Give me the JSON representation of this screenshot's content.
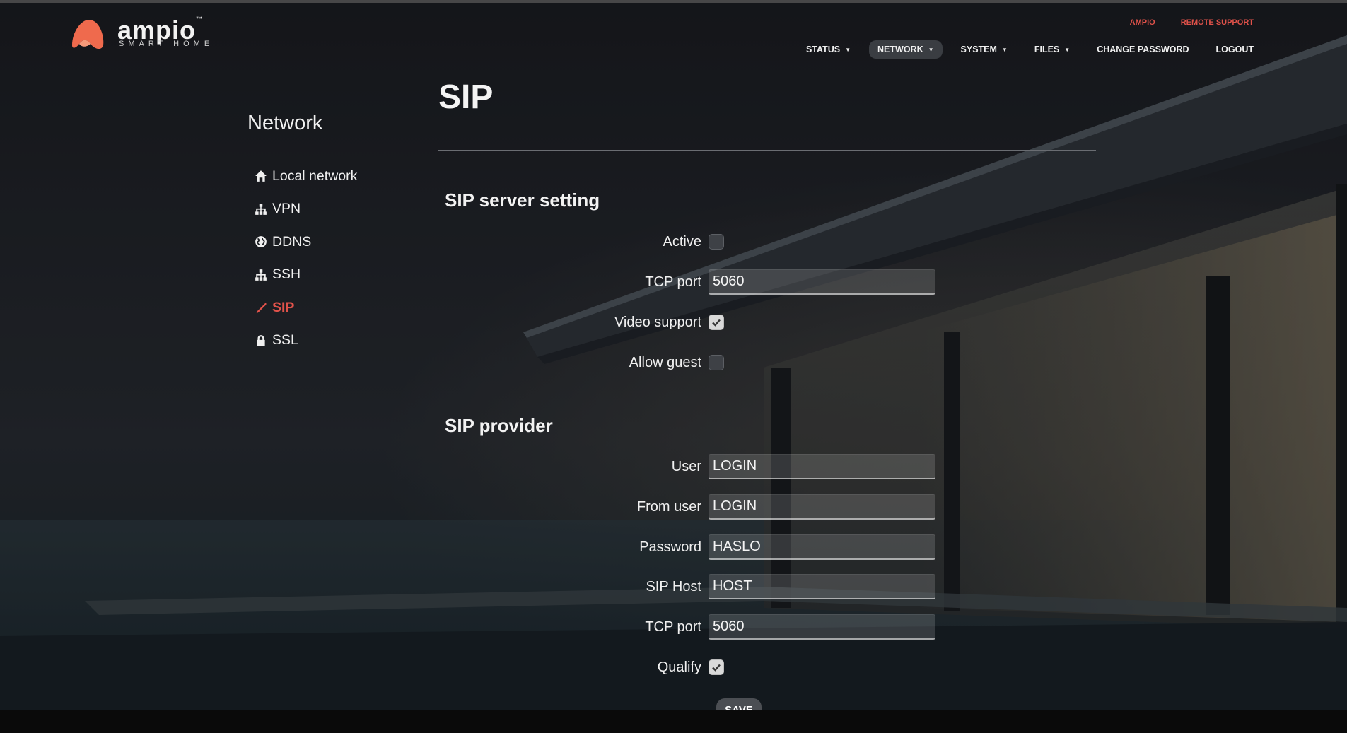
{
  "brand": {
    "name": "ampio",
    "tagline": "SMART HOME",
    "trademark": "™",
    "accent": "#e0524a"
  },
  "top_links": [
    {
      "label": "AMPIO"
    },
    {
      "label": "REMOTE SUPPORT"
    }
  ],
  "nav": [
    {
      "label": "STATUS",
      "dropdown": true
    },
    {
      "label": "NETWORK",
      "dropdown": true,
      "active": true
    },
    {
      "label": "SYSTEM",
      "dropdown": true
    },
    {
      "label": "FILES",
      "dropdown": true
    },
    {
      "label": "CHANGE PASSWORD"
    },
    {
      "label": "LOGOUT"
    }
  ],
  "sidebar": {
    "title": "Network",
    "items": [
      {
        "label": "Local network",
        "icon": "home-icon"
      },
      {
        "label": "VPN",
        "icon": "sitemap-icon"
      },
      {
        "label": "DDNS",
        "icon": "globe-icon"
      },
      {
        "label": "SSH",
        "icon": "sitemap-icon"
      },
      {
        "label": "SIP",
        "icon": "phone-icon",
        "active": true
      },
      {
        "label": "SSL",
        "icon": "lock-icon"
      }
    ]
  },
  "page": {
    "title": "SIP"
  },
  "sip_server": {
    "title": "SIP server setting",
    "active_label": "Active",
    "active": false,
    "tcp_port_label": "TCP port",
    "tcp_port": "5060",
    "video_support_label": "Video support",
    "video_support": true,
    "allow_guest_label": "Allow guest",
    "allow_guest": false
  },
  "sip_provider": {
    "title": "SIP provider",
    "user_label": "User",
    "user": "LOGIN",
    "from_user_label": "From user",
    "from_user": "LOGIN",
    "password_label": "Password",
    "password": "HASLO",
    "sip_host_label": "SIP Host",
    "sip_host": "HOST",
    "tcp_port_label": "TCP port",
    "tcp_port": "5060",
    "qualify_label": "Qualify",
    "qualify": true
  },
  "save_label": "SAVE"
}
